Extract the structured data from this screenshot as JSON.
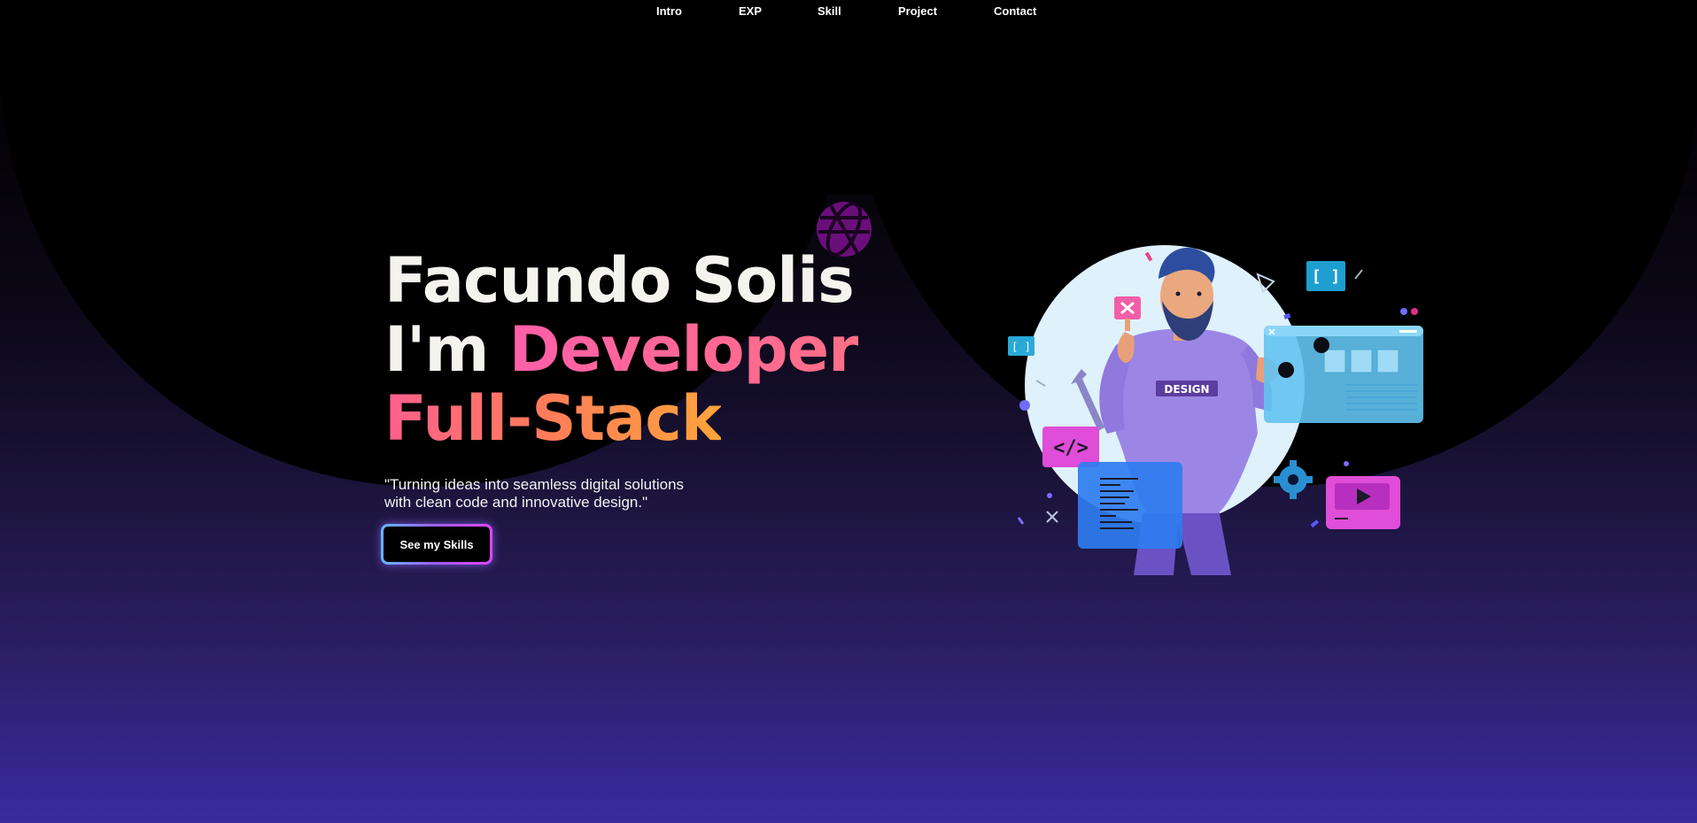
{
  "nav": {
    "items": [
      "Intro",
      "EXP",
      "Skill",
      "Project",
      "Contact"
    ]
  },
  "hero": {
    "line1": "Facundo Solis",
    "line2_prefix": "I'm ",
    "line2_accent": "Developer",
    "line3": "Full-Stack",
    "tagline": "\"Turning ideas into seamless digital solutions with clean code and innovative design.\"",
    "cta_label": "See my Skills"
  },
  "illustration": {
    "shirt_text": "DESIGN",
    "code_icon": "</>",
    "bracket_icon": "[ ]"
  },
  "icons": {
    "globe": "globe-icon",
    "play": "play-icon",
    "close": "close-icon",
    "code": "code-icon",
    "gear": "gear-icon",
    "wrench": "wrench-icon"
  },
  "colors": {
    "accent_pink": "#ff6f86",
    "accent_orange": "#ffa43a",
    "purple_bg": "#3b2aa0",
    "globe": "#6a0f7a"
  }
}
